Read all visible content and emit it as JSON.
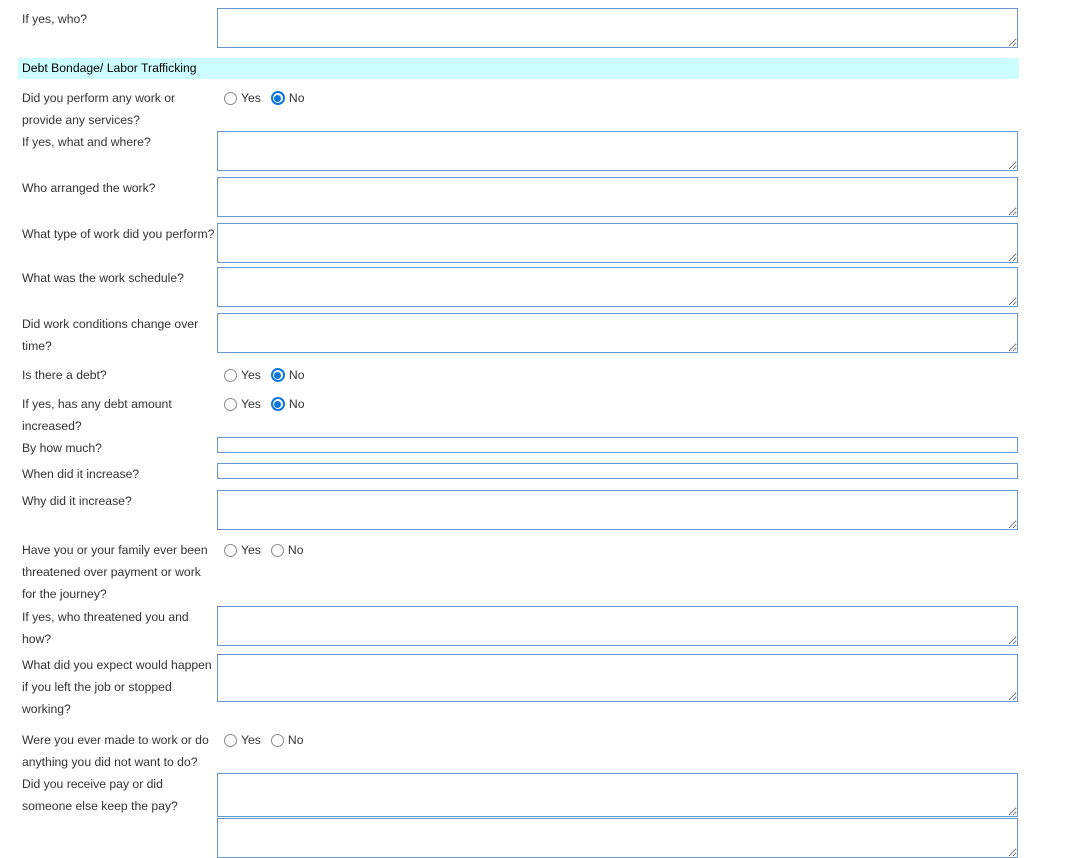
{
  "colors": {
    "field_border": "#6699cc",
    "section_bg": "#ccfeff",
    "radio_selected": "#0b76dd",
    "label_text": "#333333"
  },
  "options": {
    "yes": "Yes",
    "no": "No"
  },
  "section_header": "Debt Bondage/ Labor Trafficking",
  "rows": [
    {
      "label": "If yes, who?",
      "type": "textarea",
      "value": ""
    },
    {
      "label": "Debt Bondage/ Labor Trafficking",
      "type": "section"
    },
    {
      "label": "Did you perform any work or provide any services?",
      "type": "radio",
      "selected": "No",
      "yes_checked": false,
      "no_checked": true
    },
    {
      "label": "If yes, what and where?",
      "type": "textarea",
      "value": ""
    },
    {
      "label": "Who arranged the work?",
      "type": "textarea",
      "value": ""
    },
    {
      "label": "What type of work did you perform?",
      "type": "textarea",
      "value": ""
    },
    {
      "label": "What was the work schedule?",
      "type": "textarea",
      "value": ""
    },
    {
      "label": "Did work conditions change over time?",
      "type": "textarea",
      "value": ""
    },
    {
      "label": "Is there a debt?",
      "type": "radio",
      "selected": "No",
      "yes_checked": false,
      "no_checked": true
    },
    {
      "label": "If yes, has any debt amount increased?",
      "type": "radio",
      "selected": "No",
      "yes_checked": false,
      "no_checked": true
    },
    {
      "label": "By how much?",
      "type": "input",
      "value": ""
    },
    {
      "label": "When did it increase?",
      "type": "input",
      "value": ""
    },
    {
      "label": "Why did it increase?",
      "type": "textarea",
      "value": ""
    },
    {
      "label": "Have you or your family ever been threatened over payment or work for the journey?",
      "type": "radio",
      "selected": null,
      "yes_checked": false,
      "no_checked": false
    },
    {
      "label": "If yes, who threatened you and how?",
      "type": "textarea",
      "value": ""
    },
    {
      "label": "What did you expect would happen if you left the job or stopped working?",
      "type": "textarea",
      "value": ""
    },
    {
      "label": "Were you ever made to work or do anything you did not want to do?",
      "type": "radio",
      "selected": null,
      "yes_checked": false,
      "no_checked": false
    },
    {
      "label": "Did you receive pay or did someone else keep the pay?",
      "type": "textarea",
      "value": ""
    },
    {
      "label": "",
      "type": "textarea-partial",
      "value": ""
    }
  ]
}
